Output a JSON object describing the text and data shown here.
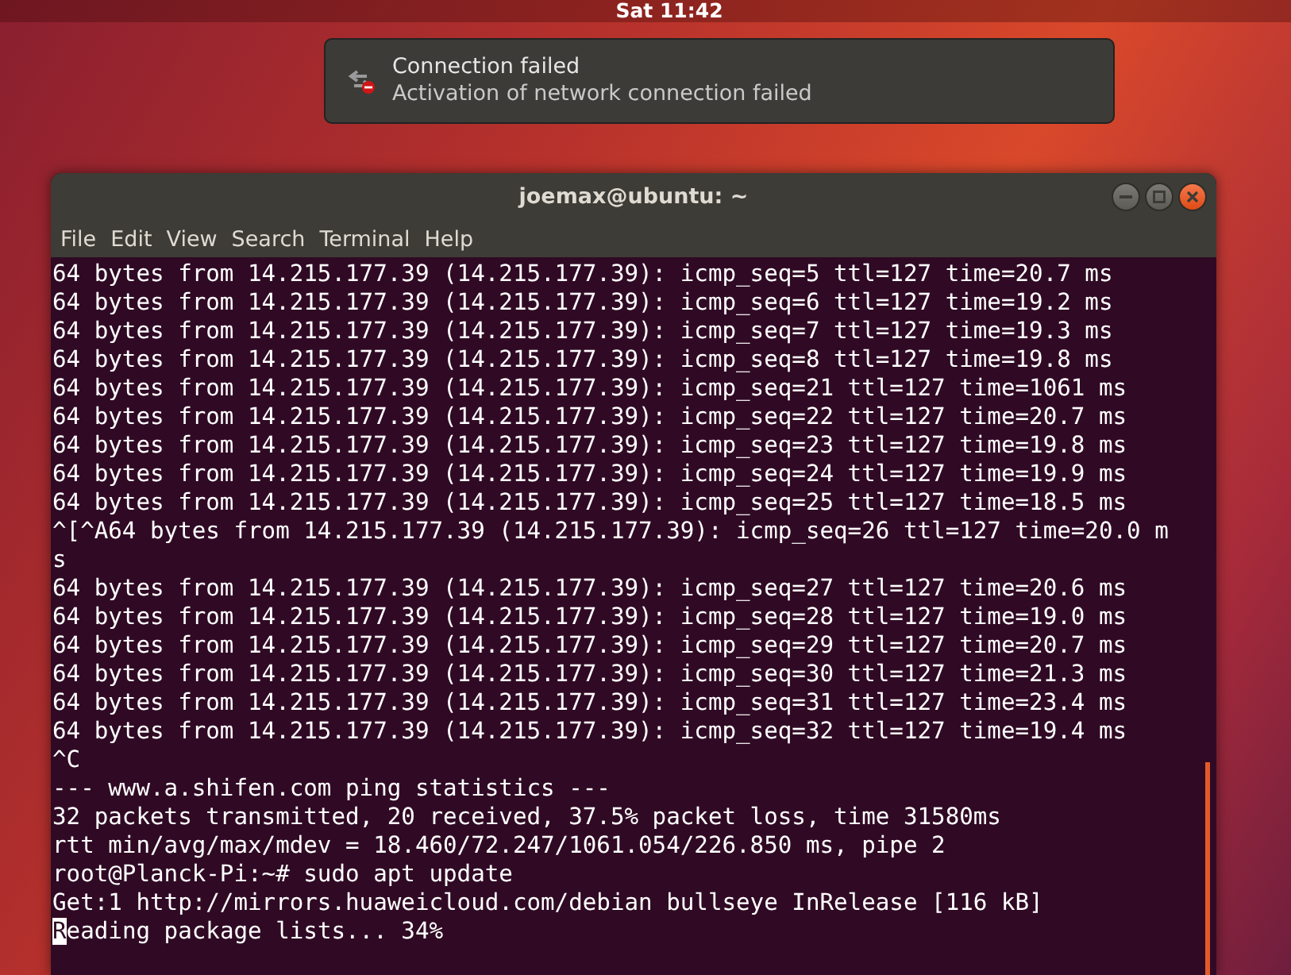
{
  "top_bar": {
    "clock": "Sat 11:42"
  },
  "notification": {
    "title": "Connection failed",
    "body": "Activation of network connection failed"
  },
  "window": {
    "title": "joemax@ubuntu: ~"
  },
  "menu": [
    "File",
    "Edit",
    "View",
    "Search",
    "Terminal",
    "Help"
  ],
  "terminal_lines": [
    {
      "text": "64 bytes from 14.215.177.39 (14.215.177.39): icmp_seq=5 ttl=127 time=20.7 ms",
      "cursor": false
    },
    {
      "text": "64 bytes from 14.215.177.39 (14.215.177.39): icmp_seq=6 ttl=127 time=19.2 ms",
      "cursor": false
    },
    {
      "text": "64 bytes from 14.215.177.39 (14.215.177.39): icmp_seq=7 ttl=127 time=19.3 ms",
      "cursor": false
    },
    {
      "text": "64 bytes from 14.215.177.39 (14.215.177.39): icmp_seq=8 ttl=127 time=19.8 ms",
      "cursor": false
    },
    {
      "text": "64 bytes from 14.215.177.39 (14.215.177.39): icmp_seq=21 ttl=127 time=1061 ms",
      "cursor": false
    },
    {
      "text": "64 bytes from 14.215.177.39 (14.215.177.39): icmp_seq=22 ttl=127 time=20.7 ms",
      "cursor": false
    },
    {
      "text": "64 bytes from 14.215.177.39 (14.215.177.39): icmp_seq=23 ttl=127 time=19.8 ms",
      "cursor": false
    },
    {
      "text": "64 bytes from 14.215.177.39 (14.215.177.39): icmp_seq=24 ttl=127 time=19.9 ms",
      "cursor": false
    },
    {
      "text": "64 bytes from 14.215.177.39 (14.215.177.39): icmp_seq=25 ttl=127 time=18.5 ms",
      "cursor": false
    },
    {
      "text": "^[^A64 bytes from 14.215.177.39 (14.215.177.39): icmp_seq=26 ttl=127 time=20.0 m",
      "cursor": false
    },
    {
      "text": "s",
      "cursor": false
    },
    {
      "text": "64 bytes from 14.215.177.39 (14.215.177.39): icmp_seq=27 ttl=127 time=20.6 ms",
      "cursor": false
    },
    {
      "text": "64 bytes from 14.215.177.39 (14.215.177.39): icmp_seq=28 ttl=127 time=19.0 ms",
      "cursor": false
    },
    {
      "text": "64 bytes from 14.215.177.39 (14.215.177.39): icmp_seq=29 ttl=127 time=20.7 ms",
      "cursor": false
    },
    {
      "text": "64 bytes from 14.215.177.39 (14.215.177.39): icmp_seq=30 ttl=127 time=21.3 ms",
      "cursor": false
    },
    {
      "text": "64 bytes from 14.215.177.39 (14.215.177.39): icmp_seq=31 ttl=127 time=23.4 ms",
      "cursor": false
    },
    {
      "text": "64 bytes from 14.215.177.39 (14.215.177.39): icmp_seq=32 ttl=127 time=19.4 ms",
      "cursor": false
    },
    {
      "text": "^C",
      "cursor": false
    },
    {
      "text": "--- www.a.shifen.com ping statistics ---",
      "cursor": false
    },
    {
      "text": "32 packets transmitted, 20 received, 37.5% packet loss, time 31580ms",
      "cursor": false
    },
    {
      "text": "rtt min/avg/max/mdev = 18.460/72.247/1061.054/226.850 ms, pipe 2",
      "cursor": false
    },
    {
      "text": "root@Planck-Pi:~# sudo apt update",
      "cursor": false
    },
    {
      "text": "Get:1 http://mirrors.huaweicloud.com/debian bullseye InRelease [116 kB]",
      "cursor": false
    },
    {
      "text": "Reading package lists... 34%",
      "cursor": true
    }
  ]
}
